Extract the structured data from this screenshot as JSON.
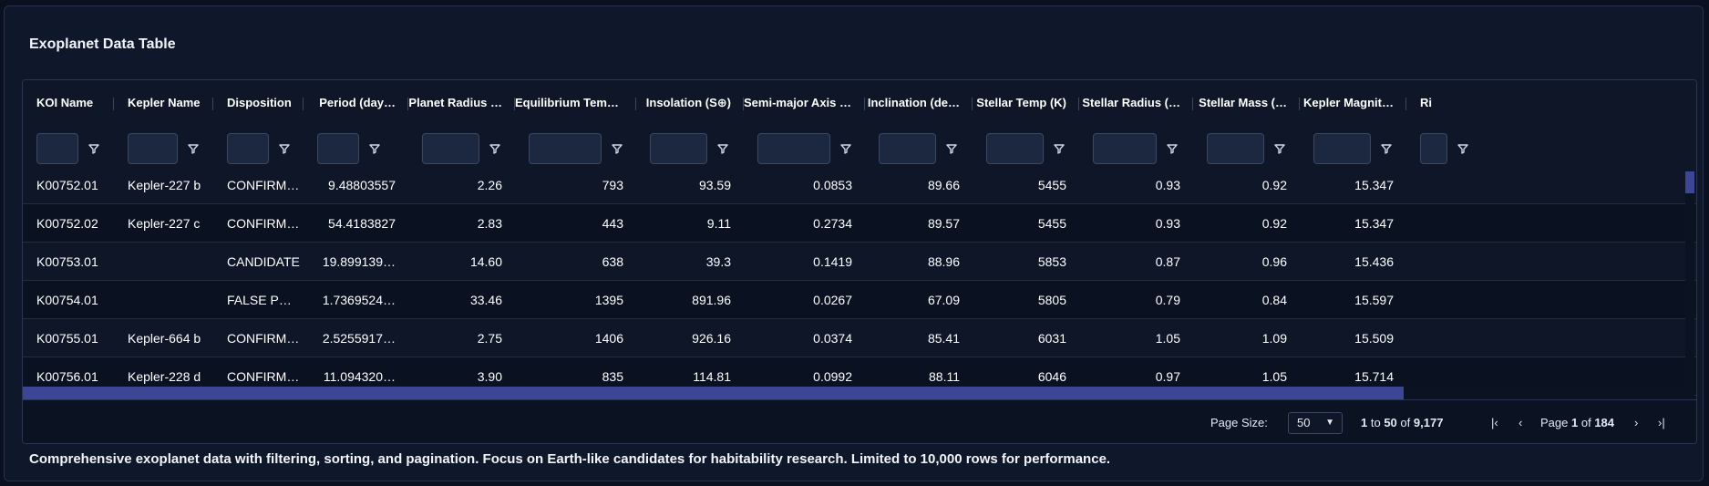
{
  "title": "Exoplanet Data Table",
  "columns": [
    "KOI Name",
    "Kepler Name",
    "Disposition",
    "Period (day…",
    "Planet Radius …",
    "Equilibrium Temp …",
    "Insolation (S⊕)",
    "Semi-major Axis (…",
    "Inclination (de…",
    "Stellar Temp (K)",
    "Stellar Radius (…",
    "Stellar Mass (…",
    "Kepler Magnit…",
    "Ri"
  ],
  "rows": [
    [
      "K00752.01",
      "Kepler-227 b",
      "CONFIRMED",
      "9.48803557",
      "2.26",
      "793",
      "93.59",
      "0.0853",
      "89.66",
      "5455",
      "0.93",
      "0.92",
      "15.347"
    ],
    [
      "K00752.02",
      "Kepler-227 c",
      "CONFIRMED",
      "54.4183827",
      "2.83",
      "443",
      "9.11",
      "0.2734",
      "89.57",
      "5455",
      "0.93",
      "0.92",
      "15.347"
    ],
    [
      "K00753.01",
      "",
      "CANDIDATE",
      "19.899139…",
      "14.60",
      "638",
      "39.3",
      "0.1419",
      "88.96",
      "5853",
      "0.87",
      "0.96",
      "15.436"
    ],
    [
      "K00754.01",
      "",
      "FALSE PO…",
      "1.7369524…",
      "33.46",
      "1395",
      "891.96",
      "0.0267",
      "67.09",
      "5805",
      "0.79",
      "0.84",
      "15.597"
    ],
    [
      "K00755.01",
      "Kepler-664 b",
      "CONFIRMED",
      "2.5255917…",
      "2.75",
      "1406",
      "926.16",
      "0.0374",
      "85.41",
      "6031",
      "1.05",
      "1.09",
      "15.509"
    ],
    [
      "K00756.01",
      "Kepler-228 d",
      "CONFIRMED",
      "11.094320…",
      "3.90",
      "835",
      "114.81",
      "0.0992",
      "88.11",
      "6046",
      "0.97",
      "1.05",
      "15.714"
    ]
  ],
  "pagination": {
    "page_size_label": "Page Size:",
    "page_size": "50",
    "row_from": "1",
    "row_to_word": "to",
    "row_to": "50",
    "of_word": "of",
    "row_total": "9,177",
    "page_word": "Page",
    "page_current": "1",
    "page_of_word": "of",
    "page_total": "184"
  },
  "caption": "Comprehensive exoplanet data with filtering, sorting, and pagination. Focus on Earth-like candidates for habitability research. Limited to 10,000 rows for performance.",
  "colors": {
    "background": "#0b1020",
    "panel": "#0f172a",
    "scroll_thumb": "#3d4694"
  }
}
